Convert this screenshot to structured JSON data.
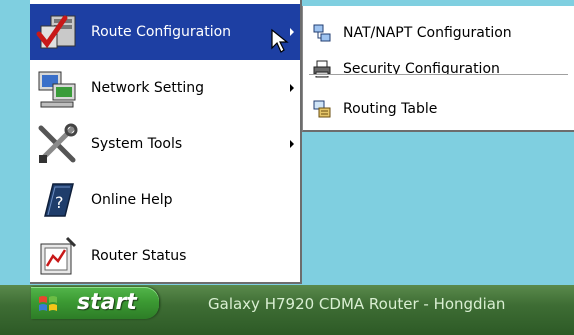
{
  "menu": {
    "items": [
      {
        "label": "Route Configuration",
        "has_submenu": true,
        "active": true,
        "icon": "route-config-icon"
      },
      {
        "label": "Network Setting",
        "has_submenu": true,
        "active": false,
        "icon": "network-computer-icon"
      },
      {
        "label": "System Tools",
        "has_submenu": true,
        "active": false,
        "icon": "tools-icon"
      },
      {
        "label": "Online Help",
        "has_submenu": false,
        "active": false,
        "icon": "help-book-icon"
      },
      {
        "label": "Router Status",
        "has_submenu": false,
        "active": false,
        "icon": "router-status-icon"
      }
    ]
  },
  "submenu": {
    "items": [
      {
        "label": "NAT/NAPT Configuration",
        "icon": "nat-icon"
      },
      {
        "label": "Security Configuration",
        "icon": "printer-icon"
      },
      {
        "label": "Routing Table",
        "icon": "routing-table-icon"
      }
    ]
  },
  "taskbar": {
    "start_label": "start",
    "window_title": "Galaxy H7920 CDMA Router - Hongdian"
  },
  "colors": {
    "desktop": "#7fcfe0",
    "menu_highlight": "#1d3fa3",
    "taskbar": "#3e6d34",
    "start_button": "#3c9a33"
  }
}
